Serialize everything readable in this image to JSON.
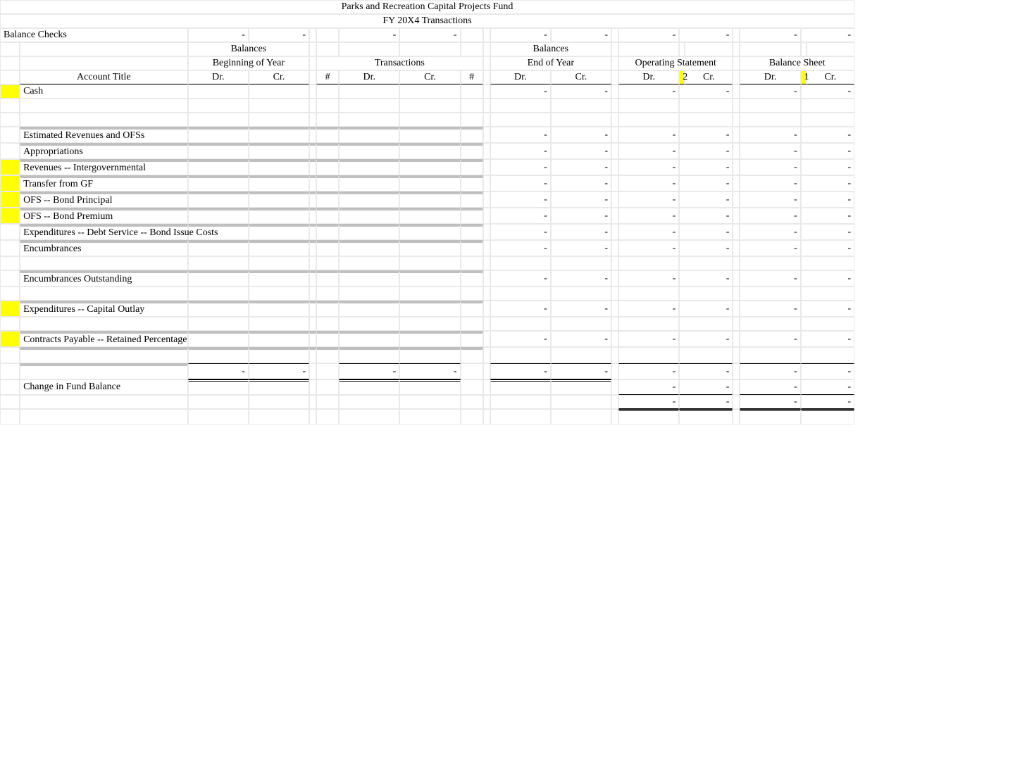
{
  "title1": "Parks and Recreation Capital Projects Fund",
  "title2": "FY 20X4 Transactions",
  "balance_checks_label": "Balance Checks",
  "dash": "-",
  "headers": {
    "balances": "Balances",
    "beg_year": "Beginning of Year",
    "transactions": "Transactions",
    "end_year": "End of Year",
    "op_stmt": "Operating Statement",
    "bal_sheet": "Balance Sheet",
    "account_title": "Account Title",
    "dr": "Dr.",
    "cr": "Cr.",
    "hash": "#"
  },
  "flag": {
    "op": "2",
    "bs": "1"
  },
  "accounts": [
    "Cash",
    "Estimated Revenues and OFSs",
    "Appropriations",
    "Revenues -- Intergovernmental",
    "Transfer from GF",
    "OFS -- Bond Principal",
    "OFS -- Bond Premium",
    "Expenditures -- Debt Service -- Bond Issue Costs",
    "Encumbrances",
    "Encumbrances Outstanding",
    "Expenditures -- Capital Outlay",
    "Contracts Payable -- Retained Percentage"
  ],
  "change_label": "Change in Fund Balance"
}
